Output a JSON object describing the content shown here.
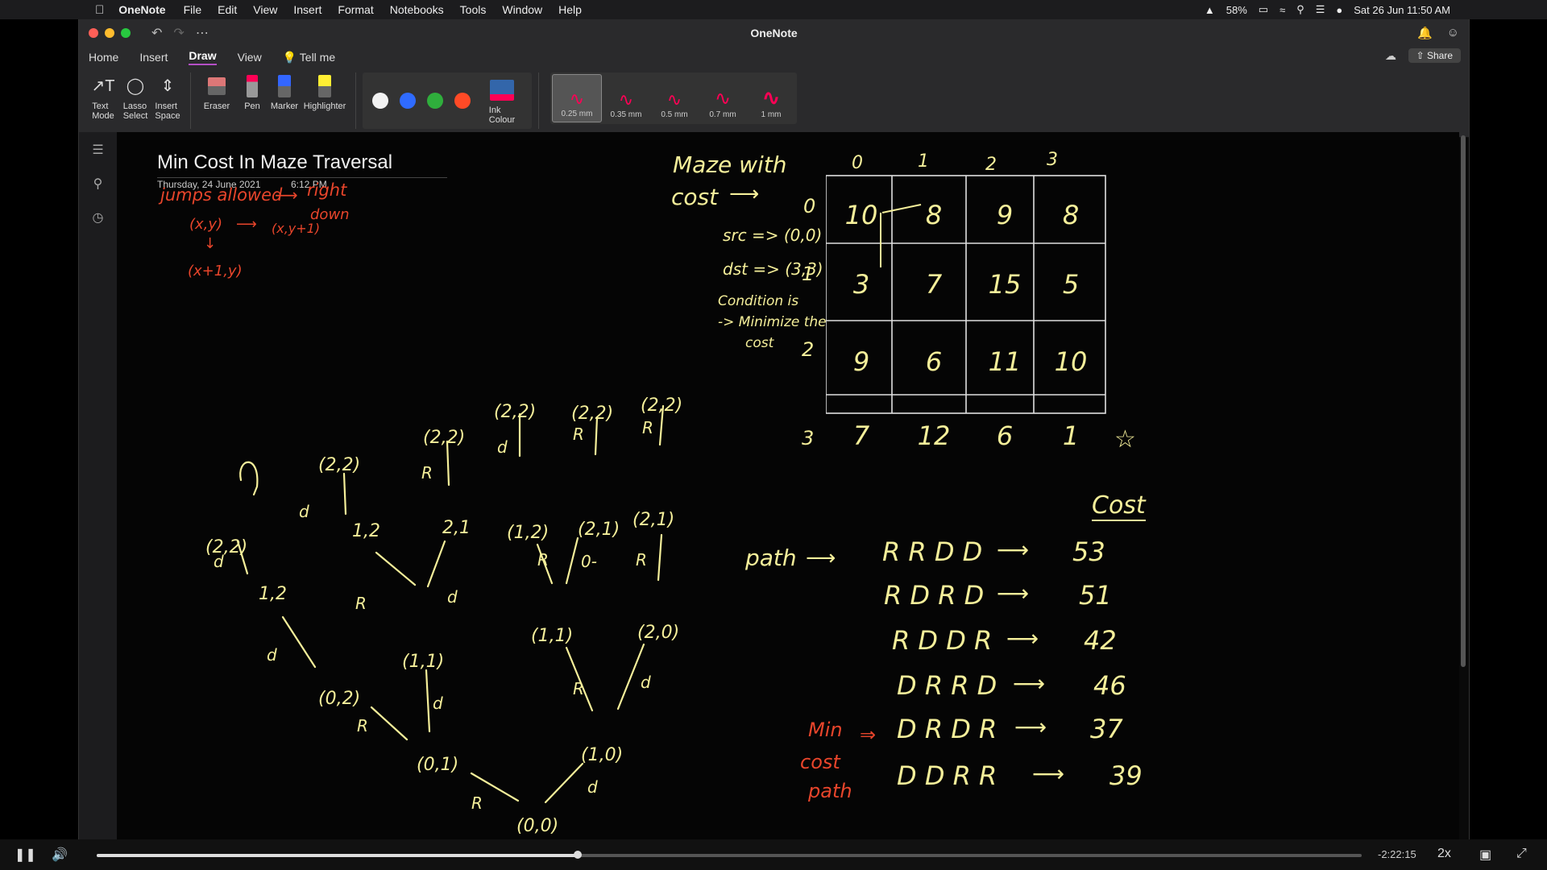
{
  "menubar": {
    "app": "OneNote",
    "items": [
      "File",
      "Edit",
      "View",
      "Insert",
      "Format",
      "Notebooks",
      "Tools",
      "Window",
      "Help"
    ],
    "battery": "58%",
    "datetime": "Sat 26 Jun  11:50 AM"
  },
  "window": {
    "title": "OneNote",
    "tabs": [
      "Home",
      "Insert",
      "Draw",
      "View"
    ],
    "active_tab": "Draw",
    "tell_me": "Tell me",
    "share": "Share"
  },
  "ribbon": {
    "tools": [
      {
        "label": "Text\nMode",
        "icon": "text-mode-icon"
      },
      {
        "label": "Lasso\nSelect",
        "icon": "lasso-icon"
      },
      {
        "label": "Insert\nSpace",
        "icon": "insert-space-icon"
      }
    ],
    "eraser": "Eraser",
    "pen": "Pen",
    "marker": "Marker",
    "highlighter": "Highlighter",
    "ink_colour": "Ink\nColour",
    "colors": [
      "#f2f2f2",
      "#2f6bff",
      "#2fae3c",
      "#ff4a26"
    ],
    "thickness": [
      "0.25 mm",
      "0.35 mm",
      "0.5 mm",
      "0.7 mm",
      "1 mm"
    ],
    "selected_thickness": "0.25 mm"
  },
  "page": {
    "title": "Min Cost In Maze Traversal",
    "date": "Thursday, 24 June 2021",
    "time": "6:12 PM"
  },
  "notes": {
    "jumps": "jumps allowed",
    "right": "right",
    "down": "down",
    "xy": "(x,y)",
    "xy1": "(x,y+1)",
    "x1y": "(x+1,y)",
    "maze": "Maze with",
    "cost": "cost",
    "src": "src => (0,0)",
    "dst": "dst => (3,3)",
    "cond1": "Condition is",
    "cond2": "-> Minimize the",
    "cond3": "cost",
    "cost_header": "Cost",
    "path_label": "path",
    "min_label1": "Min",
    "min_label2": "cost",
    "min_label3": "path"
  },
  "grid": {
    "col_headers": [
      "0",
      "1",
      "2",
      "3"
    ],
    "row_headers": [
      "0",
      "1",
      "2",
      "3"
    ],
    "rows": [
      [
        "10",
        "8",
        "9",
        "8"
      ],
      [
        "3",
        "7",
        "15",
        "5"
      ],
      [
        "9",
        "6",
        "11",
        "10"
      ],
      [
        "7",
        "12",
        "6",
        "1"
      ]
    ]
  },
  "paths": [
    {
      "seq": "R R D D",
      "cost": "53"
    },
    {
      "seq": "R D R D",
      "cost": "51"
    },
    {
      "seq": "R D D R",
      "cost": "42"
    },
    {
      "seq": "D R R D",
      "cost": "46"
    },
    {
      "seq": "D R D R",
      "cost": "37"
    },
    {
      "seq": "D D R R",
      "cost": "39"
    }
  ],
  "tree_nodes": [
    "(0,0)",
    "(0,1)",
    "(1,0)",
    "(0,2)",
    "(1,1)",
    "(1,1)",
    "(2,0)",
    "(1,2)",
    "(2,1)",
    "(1,2)",
    "(2,1)",
    "(2,1)",
    "(2,2)",
    "(2,2)",
    "(2,2)",
    "(2,2)",
    "(2,2)",
    "(2,2)"
  ],
  "player": {
    "remaining": "-2:22:15",
    "speed": "2x",
    "progress": 0.38
  }
}
